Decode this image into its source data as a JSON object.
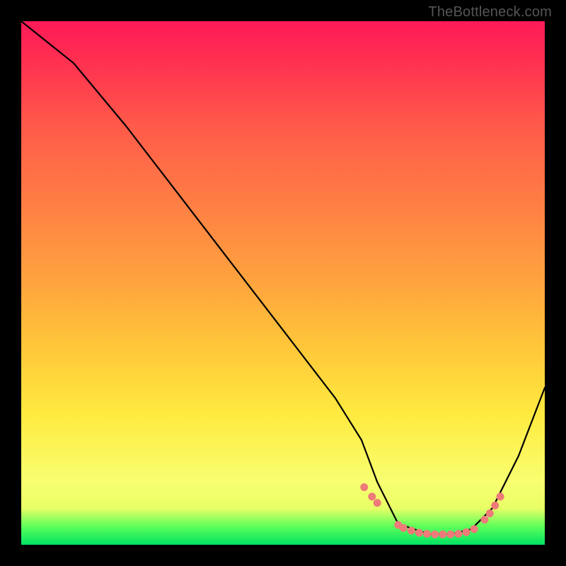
{
  "watermark": "TheBottleneck.com",
  "chart_data": {
    "type": "line",
    "title": "",
    "xlabel": "",
    "ylabel": "",
    "xlim": [
      0,
      100
    ],
    "ylim": [
      0,
      100
    ],
    "background_gradient": {
      "top": "#ff1a58",
      "upper_mid": "#ff7f44",
      "mid": "#ffea3f",
      "lower_mid": "#e9ff66",
      "bottom": "#00e263"
    },
    "series": [
      {
        "name": "bottleneck-curve",
        "x": [
          0,
          5,
          10,
          20,
          30,
          40,
          50,
          60,
          65,
          68,
          72,
          78,
          82,
          86,
          90,
          95,
          100
        ],
        "y": [
          100,
          96,
          92,
          80,
          67,
          54,
          41,
          28,
          20,
          12,
          4,
          2,
          2,
          3,
          7,
          17,
          30
        ]
      }
    ],
    "highlight_points": {
      "name": "optimal-range-dots",
      "x": [
        65.5,
        67.0,
        68.0,
        72.0,
        73.0,
        74.5,
        76.0,
        77.5,
        79.0,
        80.5,
        82.0,
        83.5,
        85.0,
        86.5,
        88.5,
        89.5,
        90.5,
        91.5
      ],
      "y": [
        11.0,
        9.2,
        8.0,
        3.8,
        3.2,
        2.7,
        2.3,
        2.1,
        2.0,
        2.0,
        2.0,
        2.1,
        2.4,
        3.0,
        4.8,
        6.0,
        7.5,
        9.2
      ]
    }
  }
}
